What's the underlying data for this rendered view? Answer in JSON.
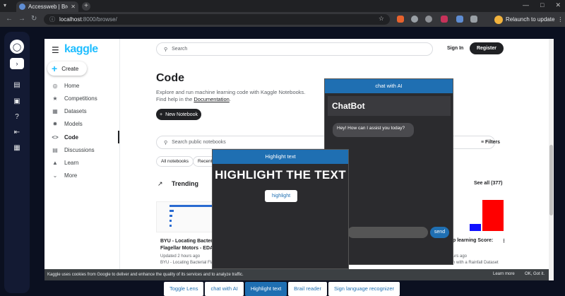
{
  "browser": {
    "tab_title": "Accessweb | Breck",
    "url_host": "localhost",
    "url_rest": ":8000/browse/",
    "relaunch_label": "Relaunch to update"
  },
  "kaggle": {
    "logo": "kaggle",
    "create_label": "Create",
    "search_placeholder": "Search",
    "signin_label": "Sign In",
    "register_label": "Register",
    "nav": [
      {
        "label": "Home",
        "icon": "home-icon"
      },
      {
        "label": "Competitions",
        "icon": "trophy-icon"
      },
      {
        "label": "Datasets",
        "icon": "table-icon"
      },
      {
        "label": "Models",
        "icon": "model-icon"
      },
      {
        "label": "Code",
        "icon": "code-icon"
      },
      {
        "label": "Discussions",
        "icon": "discussion-icon"
      },
      {
        "label": "Learn",
        "icon": "school-icon"
      },
      {
        "label": "More",
        "icon": "chevron-down-icon"
      }
    ],
    "page_title": "Code",
    "desc_line1": "Explore and run machine learning code with Kaggle Notebooks.",
    "desc_line2_prefix": "Find help in the ",
    "desc_link": "Documentation",
    "desc_suffix": ".",
    "new_notebook_label": "New Notebook",
    "notebook_search_placeholder": "Search public notebooks",
    "filters_label": "Filters",
    "chips": [
      "All notebooks",
      "Recently"
    ],
    "trending_label": "Trending",
    "see_all_label": "See all (377)",
    "card1": {
      "title": "BYU - Locating Bacterial Flagellar Motors - EDA",
      "updated": "Updated 2 hours ago",
      "source": "BYU - Locating Bacterial Fla"
    },
    "card2": {
      "title": "p learning Score:",
      "updated": "urs ago",
      "source": "n with a Rainfall Dataset"
    },
    "cookie_text": "Kaggle uses cookies from Google to deliver and enhance the quality of its services and to analyze traffic.",
    "cookie_learn": "Learn more",
    "cookie_ok": "OK, Got it."
  },
  "chat": {
    "header": "chat with AI",
    "title": "ChatBot",
    "greeting": "Hey! How can I assist you today?",
    "send_label": "send"
  },
  "highlight": {
    "header": "Highlight text",
    "big_text": "HIGHLIGHT THE TEXT",
    "button_label": "highlight"
  },
  "ext_toolbar": [
    {
      "label": "Toggle Lens",
      "active": false
    },
    {
      "label": "chat with AI",
      "active": false
    },
    {
      "label": "Highlight text",
      "active": true
    },
    {
      "label": "Brail reader",
      "active": false
    },
    {
      "label": "Sign language recognizer",
      "active": false
    }
  ],
  "colors": {
    "accent": "#1f6fb2",
    "kaggle_blue": "#20beff",
    "app_bg": "#0b1020"
  }
}
